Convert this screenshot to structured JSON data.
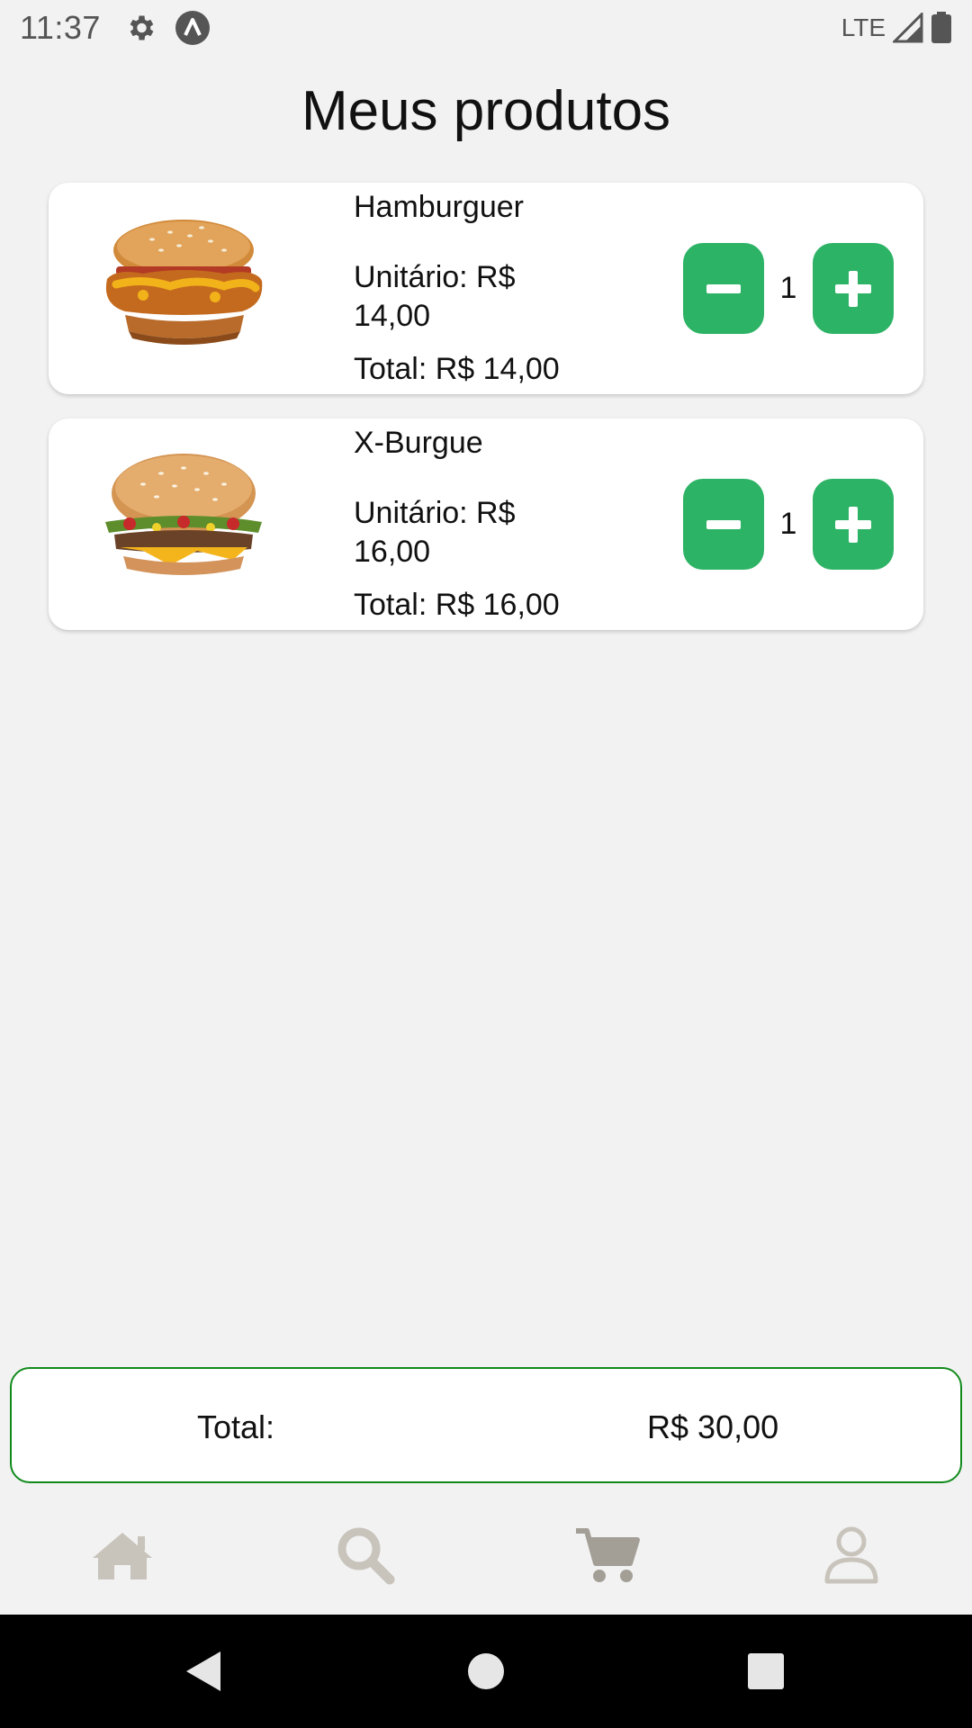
{
  "status_bar": {
    "time": "11:37",
    "network": "LTE",
    "icons": [
      "settings-icon",
      "app-indicator-icon",
      "signal-icon",
      "battery-icon"
    ]
  },
  "page": {
    "title": "Meus produtos"
  },
  "products": [
    {
      "name": "Hamburguer",
      "unit_price": "Unitário: R$ 14,00",
      "total": "Total: R$ 14,00",
      "quantity": "1",
      "image": "chicken-burger-image"
    },
    {
      "name": "X-Burgue",
      "unit_price": "Unitário: R$ 16,00",
      "total": "Total: R$ 16,00",
      "quantity": "1",
      "image": "cheeseburger-image"
    }
  ],
  "cart_total": {
    "label": "Total:",
    "value": "R$ 30,00"
  },
  "tabs": [
    "home-icon",
    "search-icon",
    "cart-icon",
    "profile-icon"
  ],
  "active_tab": "cart",
  "colors": {
    "accent": "#2db365",
    "border": "#118a1c",
    "background": "#f2f2f2",
    "inactive_icon": "#c8c4bc",
    "active_icon": "#a39f96"
  }
}
